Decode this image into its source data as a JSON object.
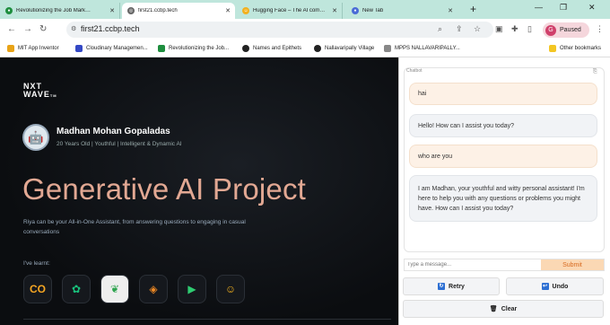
{
  "browser": {
    "tabs": [
      {
        "title": "Revolutionizing the Job Market |",
        "color": "#1e8e3e"
      },
      {
        "title": "first21.ccbp.tech",
        "color": "#666666"
      },
      {
        "title": "Hugging Face – The AI community",
        "color": "#f2b01e"
      },
      {
        "title": "New Tab",
        "color": "#4a6bd6"
      }
    ],
    "url": "first21.ccbp.tech",
    "profile": {
      "initial": "G",
      "label": "Paused"
    },
    "bookmarks": [
      "MIT App Inventor",
      "Cloudinary Managemen...",
      "Revolutionizing the Job...",
      "Names and Epithets",
      "Nallavaripally Village",
      "MPPS NALLAVARIPALLY..."
    ],
    "all_bookmarks": "Other bookmarks"
  },
  "page": {
    "logo_line1": "NXT",
    "logo_line2": "WAVE",
    "name": "Madhan Mohan Gopaladas",
    "subtitle": "20 Years Old | Youthful | Intelligent & Dynamic AI",
    "hero": "Generative AI Project",
    "description": "Riya can be your All-in-One Assistant, from answering questions to engaging in casual conversations",
    "learnt_label": "I've learnt:"
  },
  "chat": {
    "label": "Chatbot",
    "messages": [
      {
        "role": "user",
        "text": "hai"
      },
      {
        "role": "bot",
        "text": "Hello! How can I assist you today?"
      },
      {
        "role": "user",
        "text": "who are you"
      },
      {
        "role": "bot",
        "text": "I am Madhan, your youthful and witty personal assistant! I'm here to help you with any questions or problems you might have. How can I assist you today?"
      }
    ],
    "input_placeholder": "Type a message...",
    "submit_label": "Submit",
    "retry_label": "Retry",
    "undo_label": "Undo",
    "clear_label": "Clear"
  }
}
